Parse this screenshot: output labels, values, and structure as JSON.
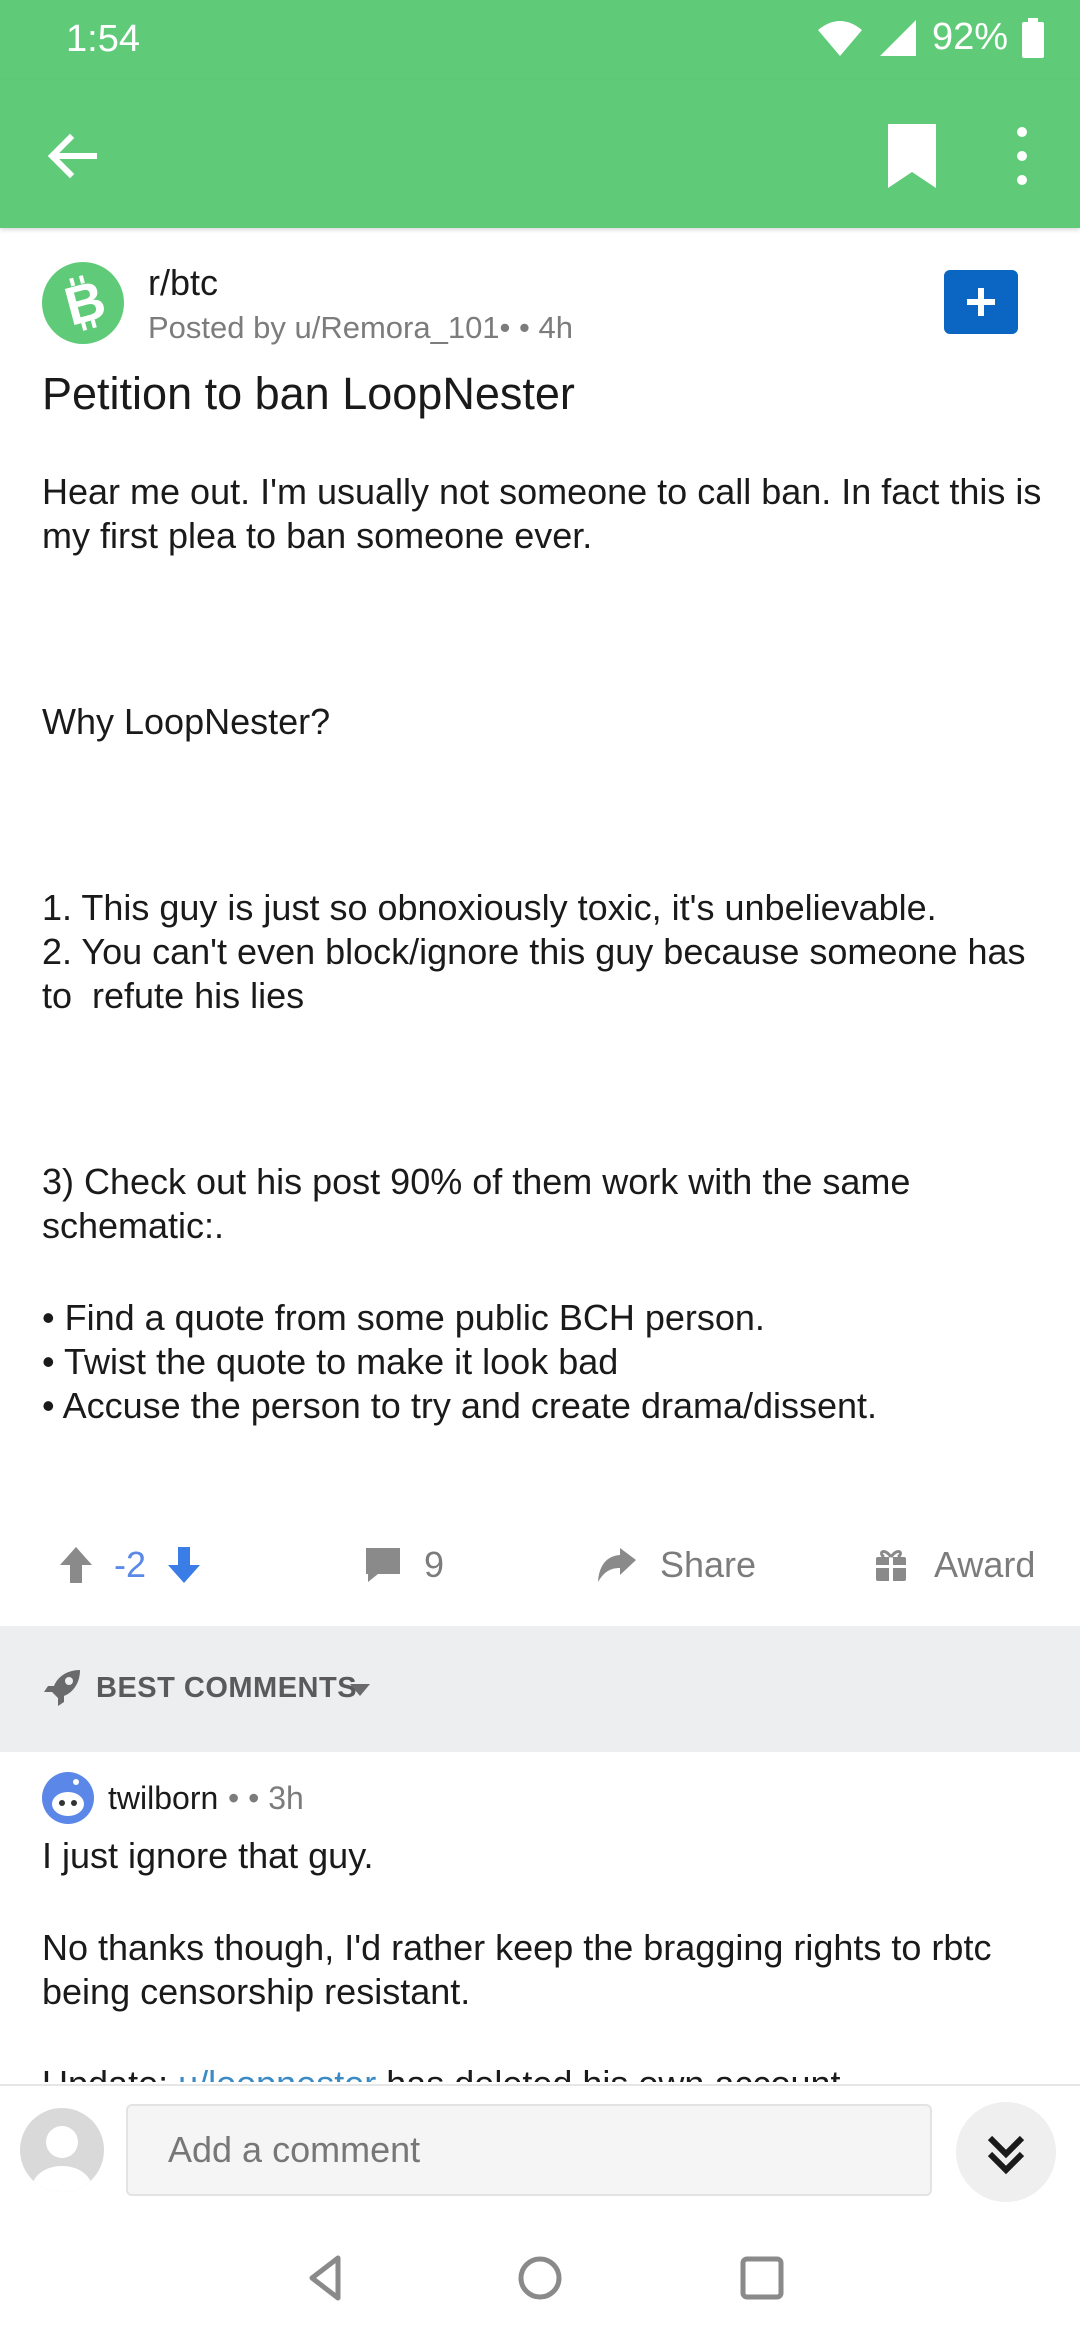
{
  "status_bar": {
    "time": "1:54",
    "battery": "92%"
  },
  "app_bar": {},
  "post": {
    "subreddit": "r/btc",
    "meta": "Posted by u/Remora_101•  • 4h",
    "title": "Petition to ban LoopNester",
    "body": {
      "p1": "Hear me out. I'm usually not someone to call ban. In fact this is my first plea to ban someone ever.",
      "p2": "Why LoopNester?",
      "p3": "1. This guy is just so obnoxiously toxic, it's unbelievable.\n2. You can't even block/ignore this guy because someone has to  refute his lies",
      "p4": "3) Check out his post 90% of them work with the same schematic:.",
      "p5": "• Find a quote from some public BCH person.\n• Twist the quote to make it look bad\n• Accuse the person to try and create drama/dissent."
    },
    "votes": "-2",
    "comments": "9",
    "share_label": "Share",
    "award_label": "Award"
  },
  "sort": {
    "label": "BEST COMMENTS"
  },
  "comment": {
    "author": "twilborn",
    "meta": "•  • 3h",
    "p1": "I just ignore that guy.",
    "p2": "No thanks though, I'd rather keep the bragging rights to rbtc being censorship resistant.",
    "p3_prefix": "Update: ",
    "p3_link": "u/loopnester",
    "p3_suffix": " has deleted his own account"
  },
  "comment_bar": {
    "placeholder": "Add a comment"
  },
  "colors": {
    "brand_green": "#5fcb78",
    "join_blue": "#0a66c2",
    "vote_blue": "#5a8ae6"
  },
  "icons": [
    "back-arrow-icon",
    "bookmark-icon",
    "more-vert-icon",
    "bitcoin-cash-icon",
    "plus-icon",
    "upvote-icon",
    "downvote-icon",
    "comment-icon",
    "share-icon",
    "award-icon",
    "rocket-icon",
    "caret-down-icon",
    "double-chevron-down-icon",
    "nav-back-icon",
    "nav-home-icon",
    "nav-recents-icon"
  ]
}
